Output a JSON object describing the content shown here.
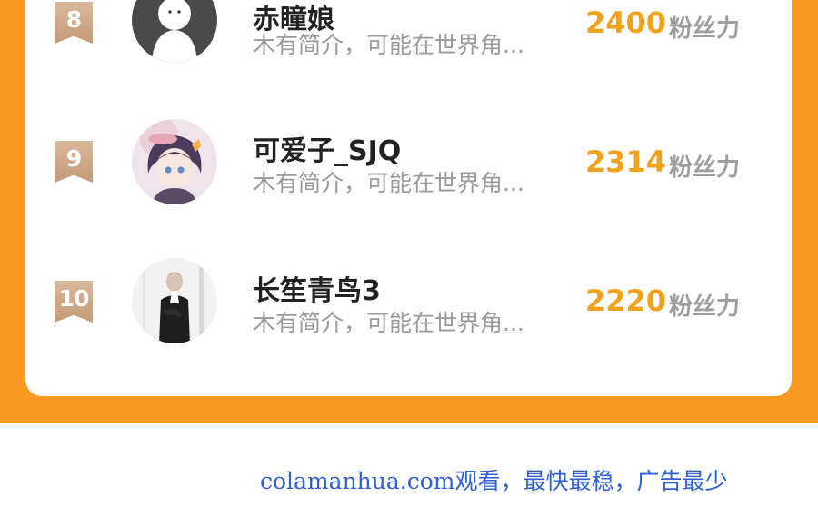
{
  "leaderboard": {
    "entries": [
      {
        "rank": "8",
        "name": "赤瞳娘",
        "bio": "木有简介，可能在世界角...",
        "fans": "2400",
        "fans_unit": "粉丝力",
        "avatar": "default-ghost-avatar"
      },
      {
        "rank": "9",
        "name": "可爱子_SJQ",
        "bio": "木有简介，可能在世界角...",
        "fans": "2314",
        "fans_unit": "粉丝力",
        "avatar": "anime-girl-avatar"
      },
      {
        "rank": "10",
        "name": "长笙青鸟3",
        "bio": "木有简介，可能在世界角...",
        "fans": "2220",
        "fans_unit": "粉丝力",
        "avatar": "man-in-suit-avatar"
      }
    ]
  },
  "watermark": {
    "text": "colamanhua.com观看，最快最稳，广告最少"
  },
  "colors": {
    "accent_orange": "#fb9a21",
    "fans_number": "#f0a21c",
    "rank_badge": "#c39a76",
    "watermark": "#2f5fd0"
  }
}
